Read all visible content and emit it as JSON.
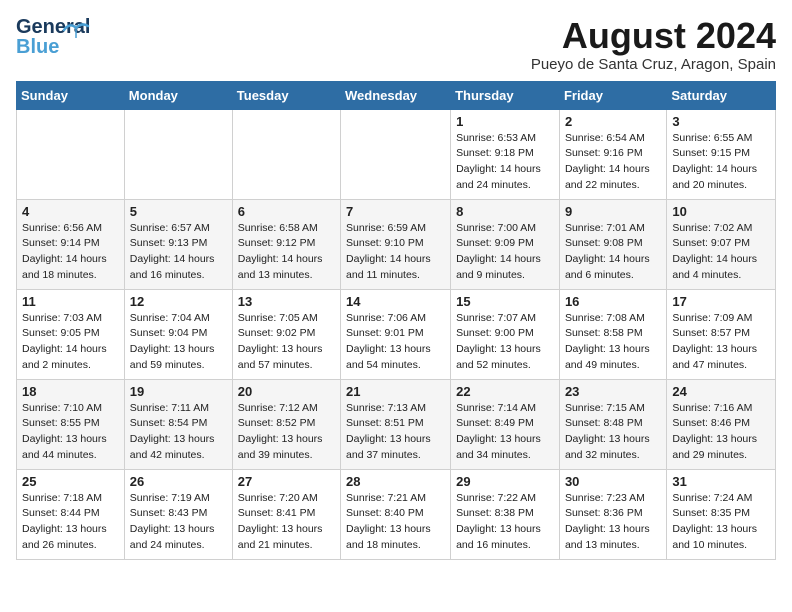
{
  "header": {
    "logo_general": "General",
    "logo_blue": "Blue",
    "title": "August 2024",
    "subtitle": "Pueyo de Santa Cruz, Aragon, Spain"
  },
  "calendar": {
    "days_of_week": [
      "Sunday",
      "Monday",
      "Tuesday",
      "Wednesday",
      "Thursday",
      "Friday",
      "Saturday"
    ],
    "weeks": [
      {
        "shade": "white",
        "days": [
          {
            "num": "",
            "info": ""
          },
          {
            "num": "",
            "info": ""
          },
          {
            "num": "",
            "info": ""
          },
          {
            "num": "",
            "info": ""
          },
          {
            "num": "1",
            "info": "Sunrise: 6:53 AM\nSunset: 9:18 PM\nDaylight: 14 hours\nand 24 minutes."
          },
          {
            "num": "2",
            "info": "Sunrise: 6:54 AM\nSunset: 9:16 PM\nDaylight: 14 hours\nand 22 minutes."
          },
          {
            "num": "3",
            "info": "Sunrise: 6:55 AM\nSunset: 9:15 PM\nDaylight: 14 hours\nand 20 minutes."
          }
        ]
      },
      {
        "shade": "shade",
        "days": [
          {
            "num": "4",
            "info": "Sunrise: 6:56 AM\nSunset: 9:14 PM\nDaylight: 14 hours\nand 18 minutes."
          },
          {
            "num": "5",
            "info": "Sunrise: 6:57 AM\nSunset: 9:13 PM\nDaylight: 14 hours\nand 16 minutes."
          },
          {
            "num": "6",
            "info": "Sunrise: 6:58 AM\nSunset: 9:12 PM\nDaylight: 14 hours\nand 13 minutes."
          },
          {
            "num": "7",
            "info": "Sunrise: 6:59 AM\nSunset: 9:10 PM\nDaylight: 14 hours\nand 11 minutes."
          },
          {
            "num": "8",
            "info": "Sunrise: 7:00 AM\nSunset: 9:09 PM\nDaylight: 14 hours\nand 9 minutes."
          },
          {
            "num": "9",
            "info": "Sunrise: 7:01 AM\nSunset: 9:08 PM\nDaylight: 14 hours\nand 6 minutes."
          },
          {
            "num": "10",
            "info": "Sunrise: 7:02 AM\nSunset: 9:07 PM\nDaylight: 14 hours\nand 4 minutes."
          }
        ]
      },
      {
        "shade": "white",
        "days": [
          {
            "num": "11",
            "info": "Sunrise: 7:03 AM\nSunset: 9:05 PM\nDaylight: 14 hours\nand 2 minutes."
          },
          {
            "num": "12",
            "info": "Sunrise: 7:04 AM\nSunset: 9:04 PM\nDaylight: 13 hours\nand 59 minutes."
          },
          {
            "num": "13",
            "info": "Sunrise: 7:05 AM\nSunset: 9:02 PM\nDaylight: 13 hours\nand 57 minutes."
          },
          {
            "num": "14",
            "info": "Sunrise: 7:06 AM\nSunset: 9:01 PM\nDaylight: 13 hours\nand 54 minutes."
          },
          {
            "num": "15",
            "info": "Sunrise: 7:07 AM\nSunset: 9:00 PM\nDaylight: 13 hours\nand 52 minutes."
          },
          {
            "num": "16",
            "info": "Sunrise: 7:08 AM\nSunset: 8:58 PM\nDaylight: 13 hours\nand 49 minutes."
          },
          {
            "num": "17",
            "info": "Sunrise: 7:09 AM\nSunset: 8:57 PM\nDaylight: 13 hours\nand 47 minutes."
          }
        ]
      },
      {
        "shade": "shade",
        "days": [
          {
            "num": "18",
            "info": "Sunrise: 7:10 AM\nSunset: 8:55 PM\nDaylight: 13 hours\nand 44 minutes."
          },
          {
            "num": "19",
            "info": "Sunrise: 7:11 AM\nSunset: 8:54 PM\nDaylight: 13 hours\nand 42 minutes."
          },
          {
            "num": "20",
            "info": "Sunrise: 7:12 AM\nSunset: 8:52 PM\nDaylight: 13 hours\nand 39 minutes."
          },
          {
            "num": "21",
            "info": "Sunrise: 7:13 AM\nSunset: 8:51 PM\nDaylight: 13 hours\nand 37 minutes."
          },
          {
            "num": "22",
            "info": "Sunrise: 7:14 AM\nSunset: 8:49 PM\nDaylight: 13 hours\nand 34 minutes."
          },
          {
            "num": "23",
            "info": "Sunrise: 7:15 AM\nSunset: 8:48 PM\nDaylight: 13 hours\nand 32 minutes."
          },
          {
            "num": "24",
            "info": "Sunrise: 7:16 AM\nSunset: 8:46 PM\nDaylight: 13 hours\nand 29 minutes."
          }
        ]
      },
      {
        "shade": "white",
        "days": [
          {
            "num": "25",
            "info": "Sunrise: 7:18 AM\nSunset: 8:44 PM\nDaylight: 13 hours\nand 26 minutes."
          },
          {
            "num": "26",
            "info": "Sunrise: 7:19 AM\nSunset: 8:43 PM\nDaylight: 13 hours\nand 24 minutes."
          },
          {
            "num": "27",
            "info": "Sunrise: 7:20 AM\nSunset: 8:41 PM\nDaylight: 13 hours\nand 21 minutes."
          },
          {
            "num": "28",
            "info": "Sunrise: 7:21 AM\nSunset: 8:40 PM\nDaylight: 13 hours\nand 18 minutes."
          },
          {
            "num": "29",
            "info": "Sunrise: 7:22 AM\nSunset: 8:38 PM\nDaylight: 13 hours\nand 16 minutes."
          },
          {
            "num": "30",
            "info": "Sunrise: 7:23 AM\nSunset: 8:36 PM\nDaylight: 13 hours\nand 13 minutes."
          },
          {
            "num": "31",
            "info": "Sunrise: 7:24 AM\nSunset: 8:35 PM\nDaylight: 13 hours\nand 10 minutes."
          }
        ]
      }
    ]
  }
}
